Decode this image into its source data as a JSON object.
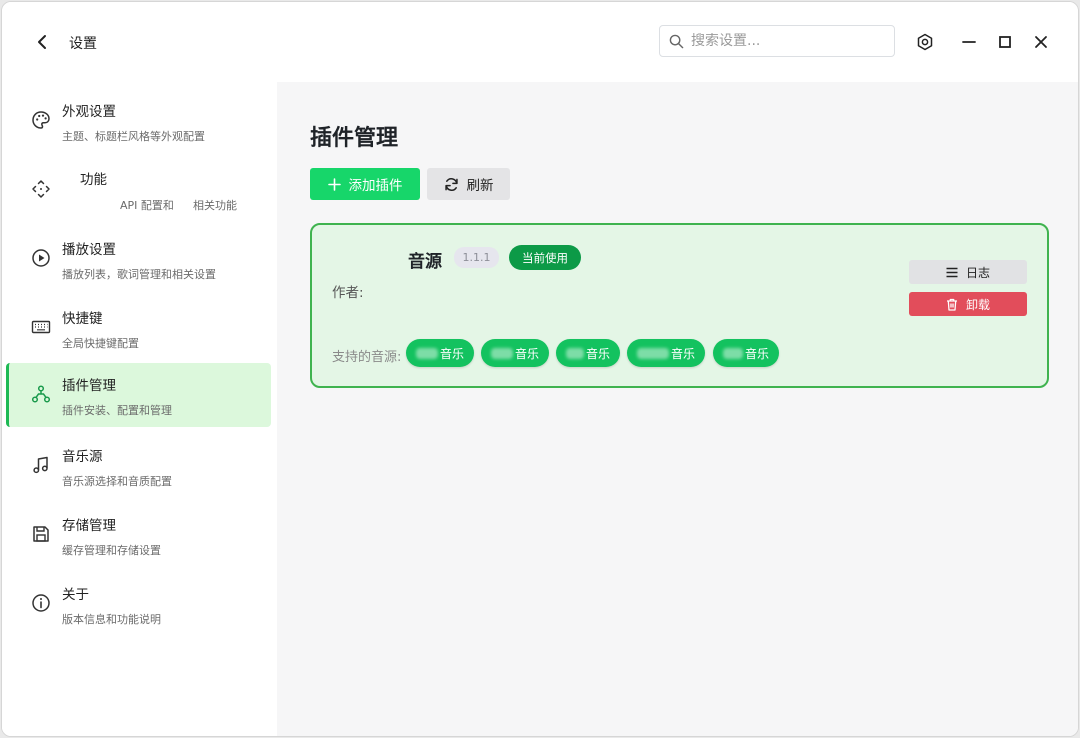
{
  "titlebar": {
    "title": "设置",
    "search_placeholder": "搜索设置..."
  },
  "sidebar": {
    "items": [
      {
        "label": "外观设置",
        "desc": "主题、标题栏风格等外观配置",
        "icon": "palette-icon"
      },
      {
        "label": "功能",
        "desc_part1": "API 配置和",
        "desc_part2": "相关功能",
        "icon": "move-dashed-icon"
      },
      {
        "label": "播放设置",
        "desc": "播放列表，歌词管理和相关设置",
        "icon": "play-circle-icon"
      },
      {
        "label": "快捷键",
        "desc": "全局快捷键配置",
        "icon": "keyboard-icon"
      },
      {
        "label": "插件管理",
        "desc": "插件安装、配置和管理",
        "icon": "plugin-network-icon",
        "active": true
      },
      {
        "label": "音乐源",
        "desc": "音乐源选择和音质配置",
        "icon": "music-note-icon"
      },
      {
        "label": "存储管理",
        "desc": "缓存管理和存储设置",
        "icon": "save-disk-icon"
      },
      {
        "label": "关于",
        "desc": "版本信息和功能说明",
        "icon": "info-icon"
      }
    ]
  },
  "main": {
    "page_title": "插件管理",
    "add_label": "添加插件",
    "refresh_label": "刷新",
    "plugin": {
      "name": "音源",
      "version": "1.1.1",
      "status_badge": "当前使用",
      "author_label": "作者:",
      "log_label": "日志",
      "uninstall_label": "卸载",
      "sources_label": "支持的音源:",
      "sources": [
        "音乐",
        "音乐",
        "音乐",
        "音乐",
        "音乐"
      ]
    }
  },
  "colors": {
    "accent": "#17d66a",
    "active_bg": "#dcf8dc",
    "badge": "#0c9a47",
    "danger": "#e24d5b"
  }
}
